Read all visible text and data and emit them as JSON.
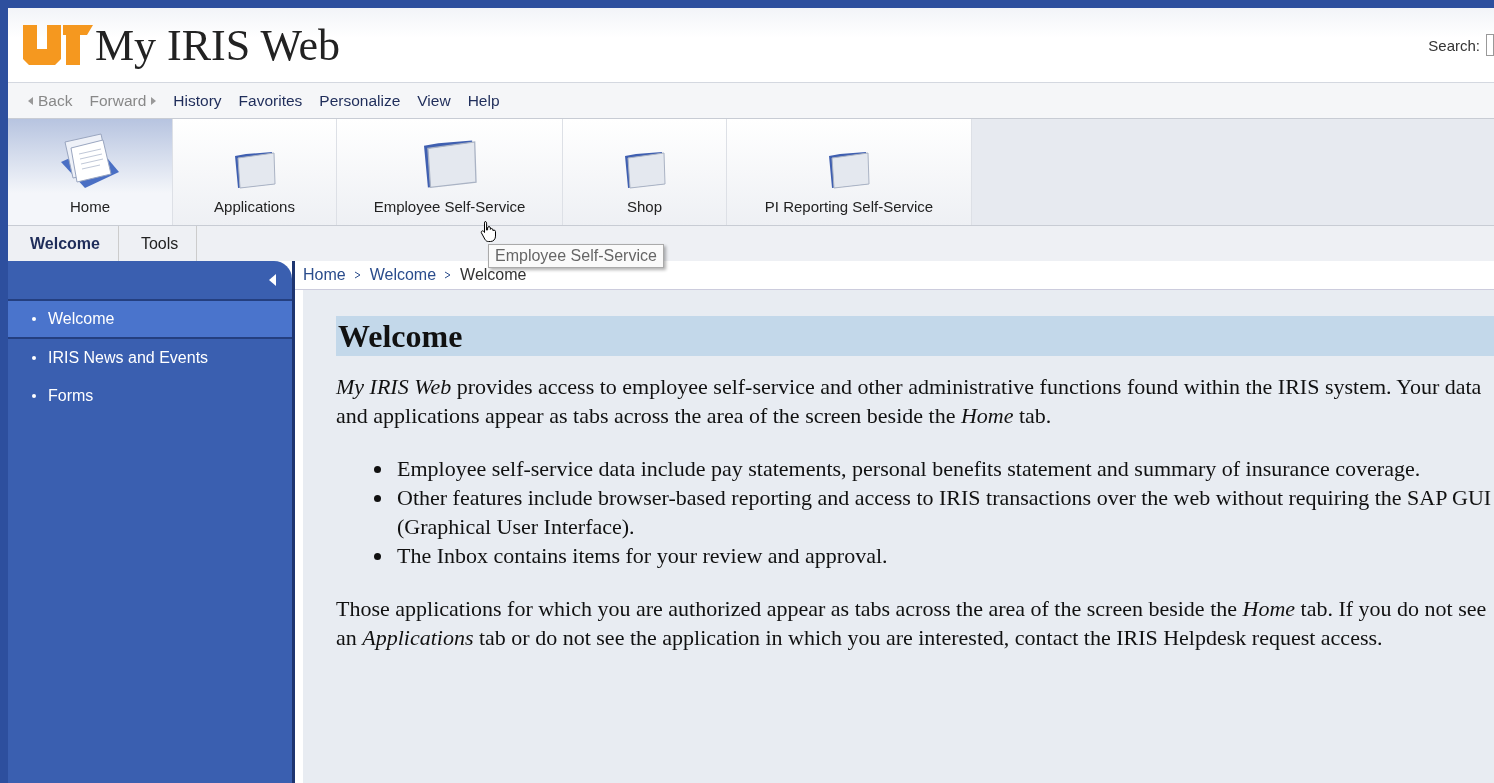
{
  "header": {
    "logo_text": "My IRIS Web",
    "search_label": "Search:"
  },
  "nav": {
    "back": "Back",
    "forward": "Forward",
    "menu": [
      "History",
      "Favorites",
      "Personalize",
      "View",
      "Help"
    ]
  },
  "tabs": [
    {
      "label": "Home",
      "kind": "home",
      "selected": true
    },
    {
      "label": "Applications",
      "kind": "folder",
      "selected": false
    },
    {
      "label": "Employee Self-Service",
      "kind": "folder",
      "selected": false
    },
    {
      "label": "Shop",
      "kind": "folder",
      "selected": false
    },
    {
      "label": "PI Reporting Self-Service",
      "kind": "folder",
      "selected": false
    }
  ],
  "subtabs": [
    {
      "label": "Welcome",
      "selected": true
    },
    {
      "label": "Tools",
      "selected": false
    }
  ],
  "tooltip": "Employee Self-Service",
  "sidebar": {
    "items": [
      {
        "label": "Welcome",
        "selected": true
      },
      {
        "label": "IRIS News and Events",
        "selected": false
      },
      {
        "label": "Forms",
        "selected": false
      }
    ]
  },
  "breadcrumb": [
    "Home",
    "Welcome",
    "Welcome"
  ],
  "content": {
    "title": "Welcome",
    "intro": "*My IRIS Web* provides access to employee self-service and other administrative functions found within the IRIS system. Your data and applications appear as tabs across the area of the screen beside the *Home* tab.",
    "bullets": [
      "Employee self-service data include pay statements, personal benefits statement and summary of insurance coverage.",
      "Other features include browser-based reporting and access to IRIS transactions over the web without requiring the SAP GUI (Graphical User Interface).",
      "The Inbox contains items for your review and approval."
    ],
    "outro": "Those applications for which you are authorized appear as tabs across the area of the screen beside the *Home* tab. If you do not see an *Applications* tab or do not see the application in which you are interested, contact the IRIS Helpdesk request access."
  }
}
